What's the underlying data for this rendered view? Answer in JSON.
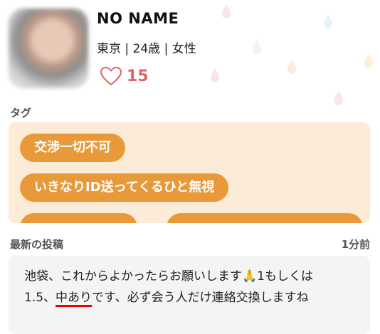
{
  "profile": {
    "name": "NO NAME",
    "meta": "東京 | 24歳 | 女性",
    "likes": "15"
  },
  "tags_section": {
    "label": "タグ",
    "tags": [
      "交渉一切不可",
      "いきなりID送ってくるひと無視",
      "",
      ""
    ]
  },
  "post_section": {
    "label": "最新の投稿",
    "time": "1分前",
    "text_part1": "池袋、これからよかったらお願いします🙏1もしくは",
    "text_part2_prefix": "1.5、",
    "text_part2_underlined": "中あり",
    "text_part2_suffix": "です、必ず会う人だけ連絡交換しますね"
  },
  "colors": {
    "accent": "#e89a3a",
    "tag_bg": "#fcebd6",
    "heart": "#e0655f",
    "post_bg": "#f4f4f4"
  },
  "icons": {
    "heart": "heart-icon",
    "avatar": "avatar"
  }
}
